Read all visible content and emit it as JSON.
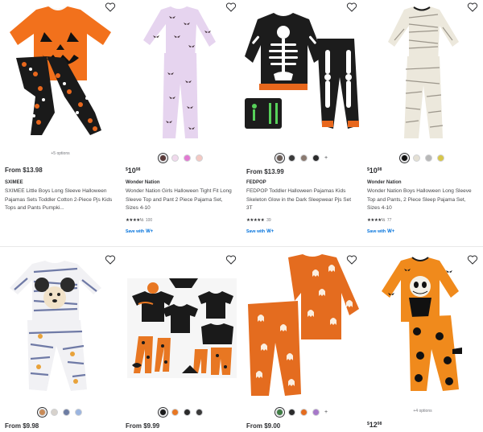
{
  "products": [
    {
      "options_text": "+5 options",
      "price_prefix": "From ",
      "price": "$13.98",
      "brand": "SXIMEE",
      "title": "SXIMEE Little Boys Long Sleeve Halloween Pajamas Sets Toddler Cotton 2-Piece Pjs Kids Tops and Pants Pumpki...",
      "heart_icon": "heart-outline-icon"
    },
    {
      "swatches": [
        "#5b3b3a",
        "#f0d9ec",
        "#e27ad2",
        "#f4c9c3"
      ],
      "price_whole": "10",
      "price_cents": "98",
      "price_currency": "$",
      "brand": "Wonder Nation",
      "title": "Wonder Nation Girls Halloween Tight Fit Long Sleeve Top and Pant 2 Piece Pajama Set, Sizes 4-10",
      "stars": "★★★★½",
      "rating_count": "100",
      "save_text": "Save with",
      "wplus": "W+",
      "heart_icon": "heart-outline-icon"
    },
    {
      "swatches": [
        "#6b5e58",
        "#3a3a3a",
        "#8a7a70",
        "#2b2b2b"
      ],
      "more": "+",
      "price_prefix": "From ",
      "price": "$13.99",
      "brand": "FEDPOP",
      "title": "FEDPOP Toddler Halloween Pajamas Kids Skeleton Glow in the Dark Sleepwear Pjs Set 3T",
      "stars": "★★★★★",
      "rating_count": "39",
      "save_text": "Save with",
      "wplus": "W+",
      "heart_icon": "heart-outline-icon"
    },
    {
      "swatches": [
        "#111111",
        "#e4e0d4",
        "#b8b8b8",
        "#d7c64a"
      ],
      "price_whole": "10",
      "price_cents": "98",
      "price_currency": "$",
      "brand": "Wonder Nation",
      "title": "Wonder Nation Boys Halloween Long Sleeve Top and Pants, 2 Piece Sleep Pajama Set, Sizes 4-10",
      "stars": "★★★★½",
      "rating_count": "77",
      "save_text": "Save with",
      "wplus": "W+",
      "heart_icon": "heart-outline-icon"
    },
    {
      "swatches": [
        "#c98b57",
        "#d7d2cc",
        "#6d7da3",
        "#9bb5e0"
      ],
      "price_prefix": "From ",
      "price": "$9.98",
      "heart_icon": "heart-outline-icon"
    },
    {
      "swatches": [
        "#1a1a1a",
        "#e87722",
        "#2b2b2b",
        "#3a3a3a"
      ],
      "price_prefix": "From ",
      "price": "$9.99",
      "heart_icon": "heart-outline-icon"
    },
    {
      "swatches": [
        "#3f7d44",
        "#2b2b2b",
        "#e46c1f",
        "#a678c9"
      ],
      "more": "+",
      "price_prefix": "From ",
      "price": "$9.00",
      "heart_icon": "heart-outline-icon"
    },
    {
      "options_text": "+4 options",
      "price_whole": "12",
      "price_cents": "98",
      "price_currency": "$",
      "heart_icon": "heart-outline-icon"
    }
  ]
}
